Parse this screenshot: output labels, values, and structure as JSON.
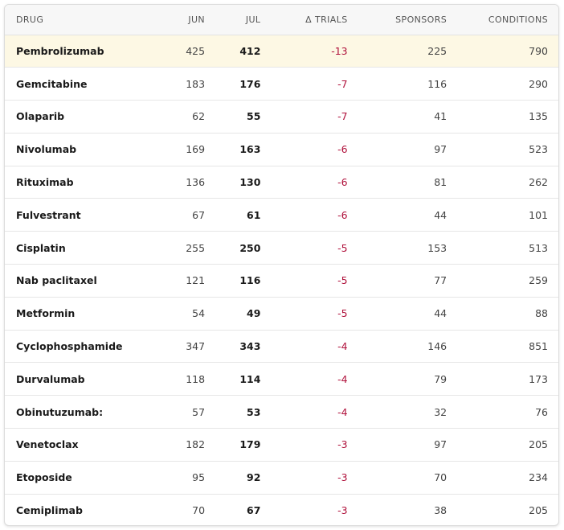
{
  "columns": {
    "drug": "DRUG",
    "jun": "JUN",
    "jul": "JUL",
    "delta": "Δ TRIALS",
    "sponsors": "SPONSORS",
    "conditions": "CONDITIONS"
  },
  "rows": [
    {
      "drug": "Pembrolizumab",
      "jun": "425",
      "jul": "412",
      "delta": "-13",
      "sponsors": "225",
      "conditions": "790"
    },
    {
      "drug": "Gemcitabine",
      "jun": "183",
      "jul": "176",
      "delta": "-7",
      "sponsors": "116",
      "conditions": "290"
    },
    {
      "drug": "Olaparib",
      "jun": "62",
      "jul": "55",
      "delta": "-7",
      "sponsors": "41",
      "conditions": "135"
    },
    {
      "drug": "Nivolumab",
      "jun": "169",
      "jul": "163",
      "delta": "-6",
      "sponsors": "97",
      "conditions": "523"
    },
    {
      "drug": "Rituximab",
      "jun": "136",
      "jul": "130",
      "delta": "-6",
      "sponsors": "81",
      "conditions": "262"
    },
    {
      "drug": "Fulvestrant",
      "jun": "67",
      "jul": "61",
      "delta": "-6",
      "sponsors": "44",
      "conditions": "101"
    },
    {
      "drug": "Cisplatin",
      "jun": "255",
      "jul": "250",
      "delta": "-5",
      "sponsors": "153",
      "conditions": "513"
    },
    {
      "drug": "Nab paclitaxel",
      "jun": "121",
      "jul": "116",
      "delta": "-5",
      "sponsors": "77",
      "conditions": "259"
    },
    {
      "drug": "Metformin",
      "jun": "54",
      "jul": "49",
      "delta": "-5",
      "sponsors": "44",
      "conditions": "88"
    },
    {
      "drug": "Cyclophosphamide",
      "jun": "347",
      "jul": "343",
      "delta": "-4",
      "sponsors": "146",
      "conditions": "851"
    },
    {
      "drug": "Durvalumab",
      "jun": "118",
      "jul": "114",
      "delta": "-4",
      "sponsors": "79",
      "conditions": "173"
    },
    {
      "drug": "Obinutuzumab:",
      "jun": "57",
      "jul": "53",
      "delta": "-4",
      "sponsors": "32",
      "conditions": "76"
    },
    {
      "drug": "Venetoclax",
      "jun": "182",
      "jul": "179",
      "delta": "-3",
      "sponsors": "97",
      "conditions": "205"
    },
    {
      "drug": "Etoposide",
      "jun": "95",
      "jul": "92",
      "delta": "-3",
      "sponsors": "70",
      "conditions": "234"
    },
    {
      "drug": "Cemiplimab",
      "jun": "70",
      "jul": "67",
      "delta": "-3",
      "sponsors": "38",
      "conditions": "205"
    }
  ],
  "highlighted_row": 0,
  "colors": {
    "delta_negative": "#b0123c",
    "highlight_bg": "#fdf8e4"
  }
}
